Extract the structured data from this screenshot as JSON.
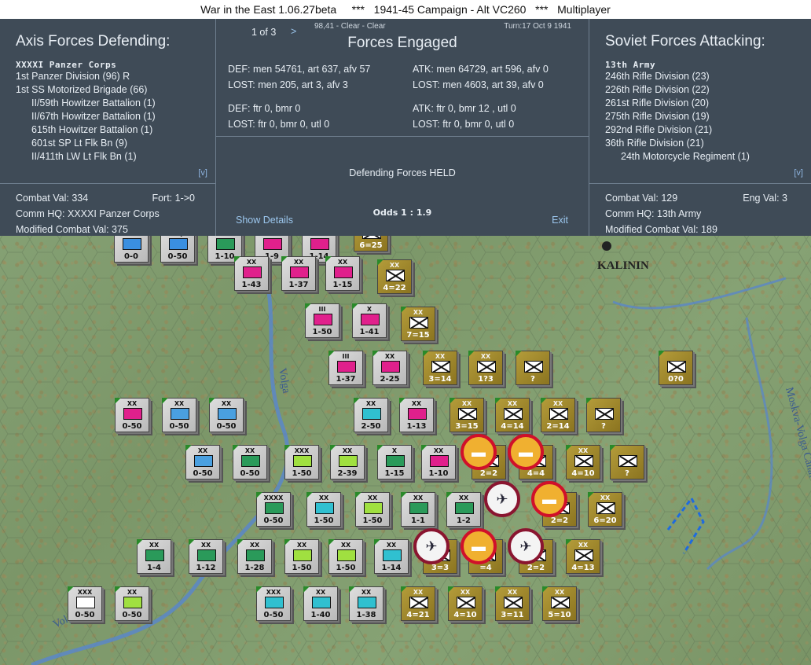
{
  "window": {
    "title": "War in the East 1.06.27beta     ***   1941-45 Campaign - Alt VC260   ***   Multiplayer"
  },
  "left_panel": {
    "title": "Axis Forces Defending:",
    "hq": "XXXXI Panzer Corps",
    "units": [
      {
        "name": "1st Panzer Division (96) R",
        "indent": false
      },
      {
        "name": "1st SS Motorized Brigade (66)",
        "indent": false
      },
      {
        "name": "II/59th Howitzer Battalion (1)",
        "indent": true
      },
      {
        "name": "II/67th Howitzer Battalion (1)",
        "indent": true
      },
      {
        "name": "615th Howitzer Battalion (1)",
        "indent": true
      },
      {
        "name": "601st SP Lt Flk Bn (9)",
        "indent": true
      },
      {
        "name": "II/411th LW Lt Flk Bn (1)",
        "indent": true
      }
    ],
    "expand": "[v]",
    "combat_val": "Combat Val: 334",
    "fort": "Fort: 1->0",
    "comm_hq": "Comm HQ: XXXXI Panzer Corps",
    "modified": "Modified Combat Val: 375"
  },
  "center_panel": {
    "pager": "1 of 3",
    "next": ">",
    "hex_info": "98,41 - Clear - Clear",
    "turn": "Turn:17  Oct 9 1941",
    "title": "Forces Engaged",
    "def_line1": "DEF: men 54761, art 637, afv 57",
    "def_lost1": "LOST: men 205, art 3, afv 3",
    "atk_line1": "ATK: men 64729, art 596, afv 0",
    "atk_lost1": "LOST: men 4603, art 39, afv 0",
    "def_line2": "DEF: ftr 0, bmr 0",
    "def_lost2": "LOST: ftr 0, bmr 0, utl 0",
    "atk_line2": "ATK: ftr 0, bmr 12 , utl 0",
    "atk_lost2": "LOST: ftr 0, bmr 0, utl 0",
    "result": "Defending Forces HELD",
    "odds": "Odds 1 : 1.9",
    "show_details": "Show Details",
    "exit": "Exit"
  },
  "right_panel": {
    "title": "Soviet Forces Attacking:",
    "hq": "13th Army",
    "units": [
      {
        "name": "246th Rifle Division (23)",
        "indent": false
      },
      {
        "name": "226th Rifle Division (22)",
        "indent": false
      },
      {
        "name": "261st Rifle Division (20)",
        "indent": false
      },
      {
        "name": "275th Rifle Division (19)",
        "indent": false
      },
      {
        "name": "292nd Rifle Division (21)",
        "indent": false
      },
      {
        "name": "36th Rifle Division (21)",
        "indent": false
      },
      {
        "name": "24th Motorcycle Regiment (1)",
        "indent": true
      }
    ],
    "expand": "[v]",
    "combat_val": "Combat Val: 129",
    "eng": "Eng Val: 3",
    "comm_hq": "Comm HQ: 13th Army",
    "modified": "Modified Combat Val: 189"
  },
  "map": {
    "city": "KALININ",
    "river_labels": [
      "Volga",
      "Volga",
      "Moskva-Volga Canal"
    ],
    "counters": [
      {
        "side": "axis",
        "size": "",
        "val": "0-0",
        "fill": "#3a8fe0"
      },
      {
        "side": "axis",
        "size": "HQ",
        "val": "0-50",
        "fill": "#3a8fe0"
      },
      {
        "side": "axis",
        "size": "",
        "val": "1-10",
        "fill": "#2a9a5a"
      },
      {
        "side": "axis",
        "size": "",
        "val": "1-9",
        "fill": "#e0208c"
      },
      {
        "side": "axis",
        "size": "",
        "val": "1-14",
        "fill": "#e0208c"
      },
      {
        "side": "axis",
        "size": "XX",
        "val": "1-43",
        "fill": "#e0208c"
      },
      {
        "side": "axis",
        "size": "XX",
        "val": "1-37",
        "fill": "#e0208c"
      },
      {
        "side": "axis",
        "size": "XX",
        "val": "1-15",
        "fill": "#e0208c"
      },
      {
        "side": "axis",
        "size": "III",
        "val": "1-50",
        "fill": "#e0208c"
      },
      {
        "side": "axis",
        "size": "X",
        "val": "1-41",
        "fill": "#e0208c"
      },
      {
        "side": "axis",
        "size": "III",
        "val": "1-37",
        "fill": "#e0208c"
      },
      {
        "side": "axis",
        "size": "XX",
        "val": "2-25",
        "fill": "#e0208c"
      },
      {
        "side": "axis",
        "size": "XX",
        "val": "0-50",
        "fill": "#e0208c"
      },
      {
        "side": "axis",
        "size": "XX",
        "val": "0-50",
        "fill": "#4aa0e0"
      },
      {
        "side": "axis",
        "size": "XX",
        "val": "0-50",
        "fill": "#4aa0e0"
      },
      {
        "side": "axis",
        "size": "XX",
        "val": "2-50",
        "fill": "#30c0d0"
      },
      {
        "side": "axis",
        "size": "XX",
        "val": "1-13",
        "fill": "#e0208c"
      },
      {
        "side": "axis",
        "size": "XX",
        "val": "0-50",
        "fill": "#4aa0e0"
      },
      {
        "side": "axis",
        "size": "XX",
        "val": "0-50",
        "fill": "#2a9a5a"
      },
      {
        "side": "axis",
        "size": "XXX",
        "val": "1-50",
        "fill": "#a0e040"
      },
      {
        "side": "axis",
        "size": "XX",
        "val": "2-39",
        "fill": "#a0e040"
      },
      {
        "side": "axis",
        "size": "X",
        "val": "1-15",
        "fill": "#2a9a5a"
      },
      {
        "side": "axis",
        "size": "XX",
        "val": "1-10",
        "fill": "#e0208c"
      },
      {
        "side": "axis",
        "size": "XXXX",
        "val": "0-50",
        "fill": "#2a9a5a"
      },
      {
        "side": "axis",
        "size": "XX",
        "val": "1-50",
        "fill": "#30c0d0"
      },
      {
        "side": "axis",
        "size": "XX",
        "val": "1-50",
        "fill": "#a0e040"
      },
      {
        "side": "axis",
        "size": "XX",
        "val": "1-1",
        "fill": "#2a9a5a"
      },
      {
        "side": "axis",
        "size": "XX",
        "val": "1-2",
        "fill": "#2a9a5a"
      },
      {
        "side": "axis",
        "size": "XX",
        "val": "1-4",
        "fill": "#2a9a5a"
      },
      {
        "side": "axis",
        "size": "XX",
        "val": "1-12",
        "fill": "#2a9a5a"
      },
      {
        "side": "axis",
        "size": "XX",
        "val": "1-28",
        "fill": "#2a9a5a"
      },
      {
        "side": "axis",
        "size": "XX",
        "val": "1-50",
        "fill": "#a0e040"
      },
      {
        "side": "axis",
        "size": "XX",
        "val": "1-50",
        "fill": "#a0e040"
      },
      {
        "side": "axis",
        "size": "XX",
        "val": "1-14",
        "fill": "#30c0d0"
      },
      {
        "side": "axis",
        "size": "XXX",
        "val": "0-50",
        "fill": "#ffffff"
      },
      {
        "side": "axis",
        "size": "XX",
        "val": "0-50",
        "fill": "#a0e040"
      },
      {
        "side": "axis",
        "size": "XXX",
        "val": "0-50",
        "fill": "#30c0d0"
      },
      {
        "side": "axis",
        "size": "XX",
        "val": "1-40",
        "fill": "#30c0d0"
      },
      {
        "side": "axis",
        "size": "XX",
        "val": "1-38",
        "fill": "#30c0d0"
      },
      {
        "side": "sov",
        "size": "",
        "val": "6=25",
        "fill": "#ffffff"
      },
      {
        "side": "sov",
        "size": "XX",
        "val": "4=22",
        "fill": "#ffffff"
      },
      {
        "side": "sov",
        "size": "XX",
        "val": "7=15",
        "fill": "#ffffff"
      },
      {
        "side": "sov",
        "size": "XX",
        "val": "3=14",
        "fill": "#ffffff"
      },
      {
        "side": "sov",
        "size": "XX",
        "val": "1?3",
        "fill": "#ffffff"
      },
      {
        "side": "sov",
        "size": "",
        "val": "?",
        "fill": "#ffffff"
      },
      {
        "side": "sov",
        "size": "",
        "val": "0?0",
        "fill": "#ffffff"
      },
      {
        "side": "sov",
        "size": "XX",
        "val": "3=15",
        "fill": "#ffffff"
      },
      {
        "side": "sov",
        "size": "XX",
        "val": "4=14",
        "fill": "#ffffff"
      },
      {
        "side": "sov",
        "size": "XX",
        "val": "2=14",
        "fill": "#ffffff"
      },
      {
        "side": "sov",
        "size": "",
        "val": "?",
        "fill": "#ffffff"
      },
      {
        "side": "sov",
        "size": "XX",
        "val": "2=2",
        "fill": "#ffffff"
      },
      {
        "side": "sov",
        "size": "XX",
        "val": "4=4",
        "fill": "#ffffff"
      },
      {
        "side": "sov",
        "size": "XX",
        "val": "4=10",
        "fill": "#ffffff"
      },
      {
        "side": "sov",
        "size": "",
        "val": "?",
        "fill": "#ffffff"
      },
      {
        "side": "sov",
        "size": "XX",
        "val": "2=2",
        "fill": "#ffffff"
      },
      {
        "side": "sov",
        "size": "XX",
        "val": "6=20",
        "fill": "#ffffff"
      },
      {
        "side": "sov",
        "size": "XX",
        "val": "3=3",
        "fill": "#ffffff"
      },
      {
        "side": "sov",
        "size": "XX",
        "val": "=4",
        "fill": "#ffffff"
      },
      {
        "side": "sov",
        "size": "XX",
        "val": "2=2",
        "fill": "#ffffff"
      },
      {
        "side": "sov",
        "size": "XX",
        "val": "4=13",
        "fill": "#ffffff"
      },
      {
        "side": "sov",
        "size": "XX",
        "val": "4=21",
        "fill": "#ffffff"
      },
      {
        "side": "sov",
        "size": "XX",
        "val": "4=10",
        "fill": "#ffffff"
      },
      {
        "side": "sov",
        "size": "XX",
        "val": "3=11",
        "fill": "#ffffff"
      },
      {
        "side": "sov",
        "size": "XX",
        "val": "5=10",
        "fill": "#ffffff"
      }
    ],
    "badges": [
      {
        "kind": "tank"
      },
      {
        "kind": "tank"
      },
      {
        "kind": "air"
      },
      {
        "kind": "tank"
      },
      {
        "kind": "air"
      },
      {
        "kind": "tank"
      },
      {
        "kind": "air"
      }
    ]
  }
}
